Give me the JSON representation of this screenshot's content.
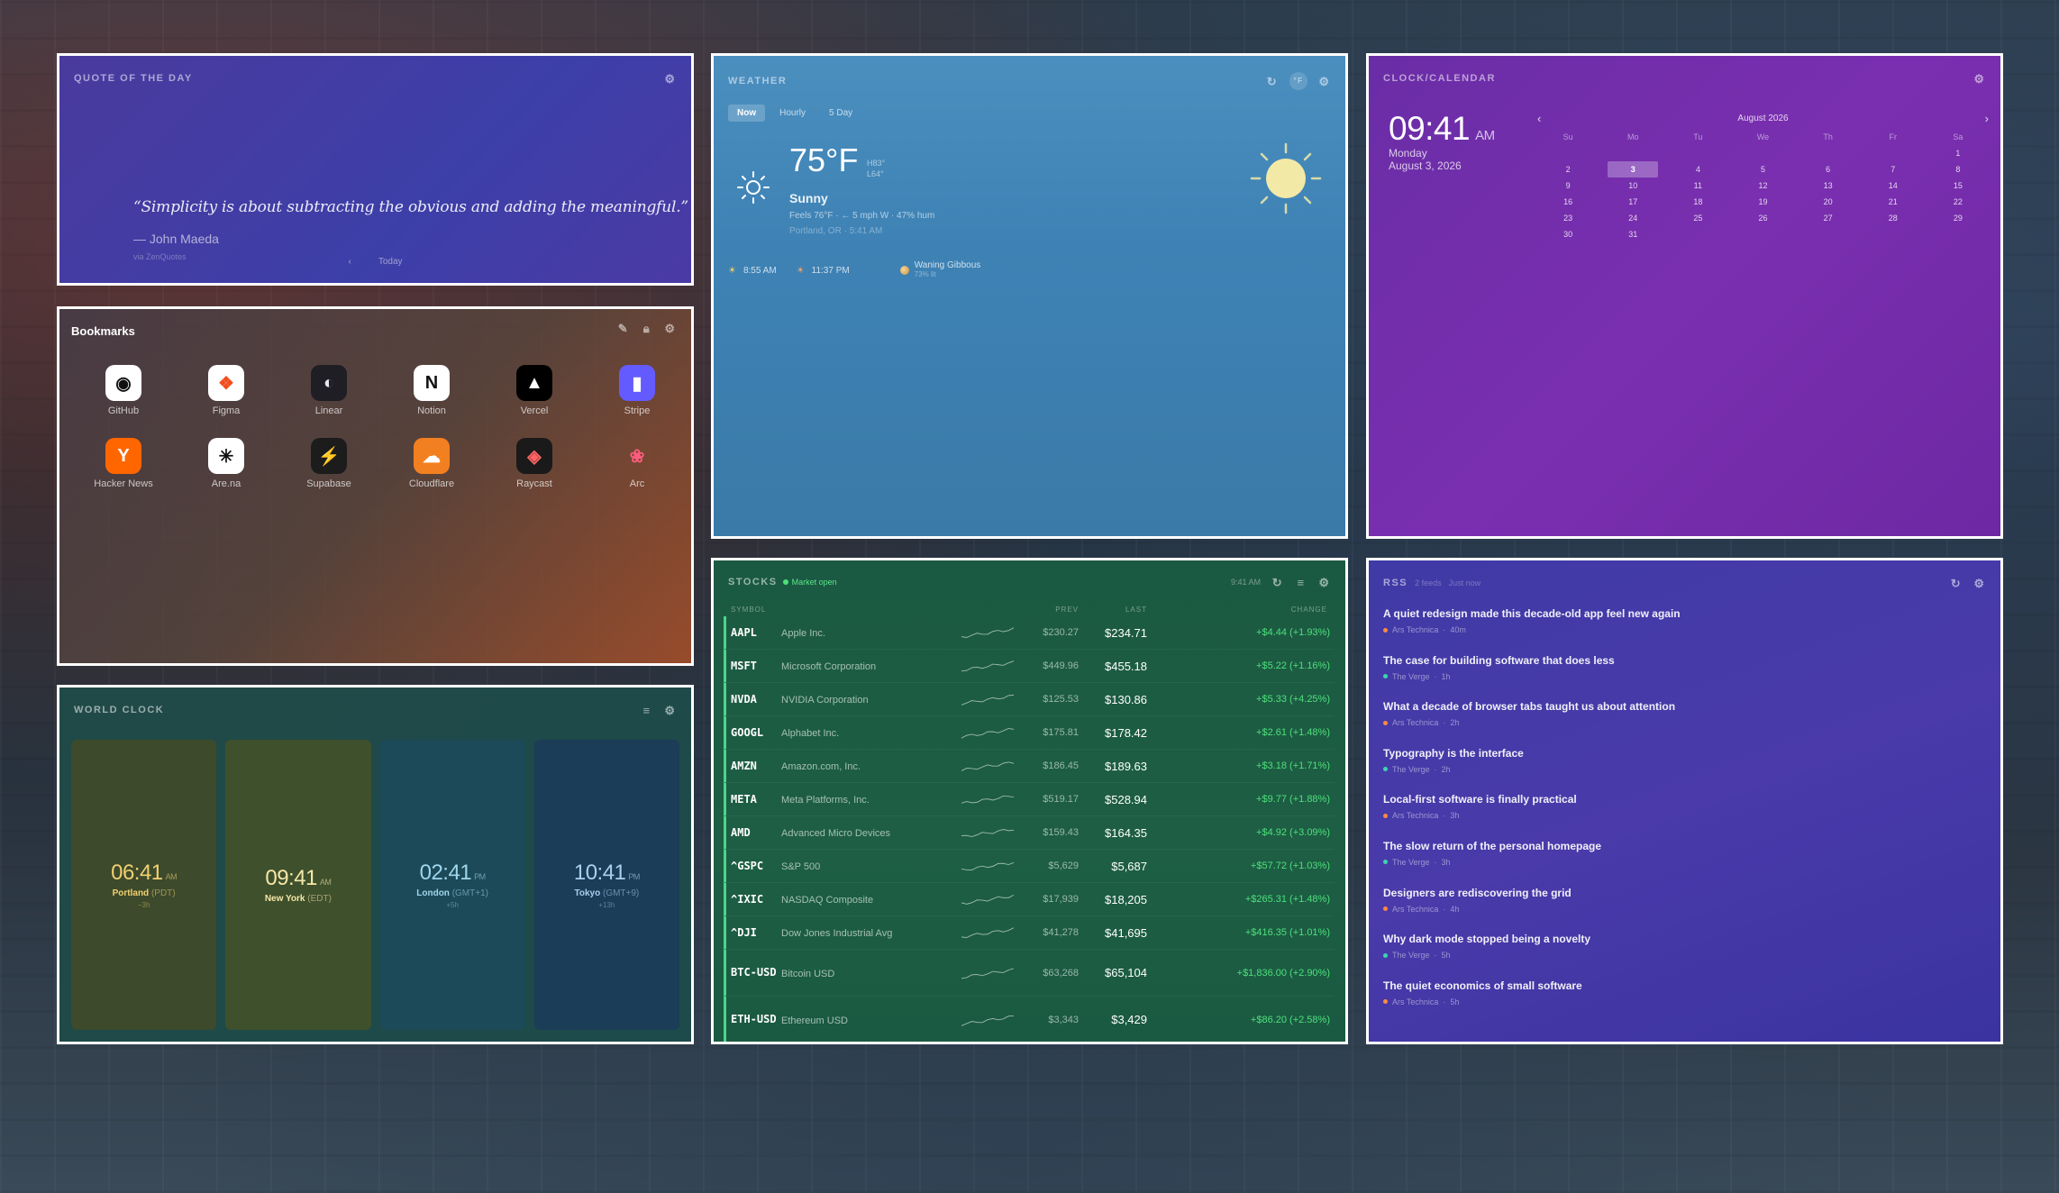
{
  "quote": {
    "title": "QUOTE OF THE DAY",
    "text": "“Simplicity is about subtracting the obvious and adding the meaningful.”",
    "author": "— John Maeda",
    "source": "via ZenQuotes",
    "nav_prev": "‹",
    "nav_label": "Today"
  },
  "bookmarks": {
    "title": "Bookmarks",
    "items": [
      {
        "label": "GitHub",
        "glyph": "◉",
        "bg": "#ffffff",
        "fg": "#111111",
        "icon": "github-icon"
      },
      {
        "label": "Figma",
        "glyph": "❖",
        "bg": "#ffffff",
        "fg": "#f24e1e",
        "icon": "figma-icon"
      },
      {
        "label": "Linear",
        "glyph": "◐",
        "bg": "#1e1e24",
        "fg": "#e6e6ef",
        "icon": "linear-icon"
      },
      {
        "label": "Notion",
        "glyph": "N",
        "bg": "#ffffff",
        "fg": "#111111",
        "icon": "notion-icon"
      },
      {
        "label": "Vercel",
        "glyph": "▲",
        "bg": "#000000",
        "fg": "#ffffff",
        "icon": "vercel-icon"
      },
      {
        "label": "Stripe",
        "glyph": "▮",
        "bg": "#635bff",
        "fg": "#ffffff",
        "icon": "stripe-icon"
      },
      {
        "label": "Hacker News",
        "glyph": "Y",
        "bg": "#ff6600",
        "fg": "#ffffff",
        "icon": "hacker-news-icon"
      },
      {
        "label": "Are.na",
        "glyph": "✳",
        "bg": "#ffffff",
        "fg": "#111111",
        "icon": "arena-icon"
      },
      {
        "label": "Supabase",
        "glyph": "⚡",
        "bg": "#1c1c1c",
        "fg": "#3ecf8e",
        "icon": "supabase-icon"
      },
      {
        "label": "Cloudflare",
        "glyph": "☁",
        "bg": "#f38020",
        "fg": "#ffffff",
        "icon": "cloudflare-icon"
      },
      {
        "label": "Raycast",
        "glyph": "◈",
        "bg": "#1a1a1a",
        "fg": "#ff6363",
        "icon": "raycast-icon"
      },
      {
        "label": "Arc",
        "glyph": "❀",
        "bg": "transparent",
        "fg": "#fc5c7d",
        "icon": "arc-icon"
      }
    ]
  },
  "worldclock": {
    "title": "WORLD CLOCK",
    "clocks": [
      {
        "time": "06:41",
        "ampm": "AM",
        "city": "Portland",
        "tz": "(PDT)",
        "offset": "−3h",
        "bg": "#3d4a2c",
        "fg": "#f0d170"
      },
      {
        "time": "09:41",
        "ampm": "AM",
        "city": "New York",
        "tz": "(EDT)",
        "offset": "",
        "bg": "#3f502c",
        "fg": "#f5e7a8"
      },
      {
        "time": "02:41",
        "ampm": "PM",
        "city": "London",
        "tz": "(GMT+1)",
        "offset": "+5h",
        "bg": "#1c4a58",
        "fg": "#9fd6ec"
      },
      {
        "time": "10:41",
        "ampm": "PM",
        "city": "Tokyo",
        "tz": "(GMT+9)",
        "offset": "+13h",
        "bg": "#1b3d58",
        "fg": "#a9cff0"
      }
    ]
  },
  "weather": {
    "title": "WEATHER",
    "unit_toggle": "°F",
    "tabs": [
      "Now",
      "Hourly",
      "5 Day"
    ],
    "temp": "75°F",
    "high": "H83°",
    "low": "L64°",
    "condition": "Sunny",
    "feels": "Feels 76°F  ·  ← 5 mph W  ·  47% hum",
    "location": "Portland, OR · 5:41 AM",
    "sunrise": "8:55 AM",
    "sunset": "11:37 PM",
    "moon_phase": "Waning Gibbous",
    "moon_illum": "73% lit"
  },
  "clock": {
    "title": "CLOCK/CALENDAR",
    "time": "09:41",
    "ampm": "AM",
    "weekday": "Monday",
    "date": "August 3, 2026",
    "month_label": "August 2026",
    "prev": "‹",
    "next": "›",
    "dow": [
      "Su",
      "Mo",
      "Tu",
      "We",
      "Th",
      "Fr",
      "Sa"
    ],
    "today": "3",
    "weeks": [
      [
        "",
        "",
        "",
        "",
        "",
        "",
        "1"
      ],
      [
        "2",
        "3",
        "4",
        "5",
        "6",
        "7",
        "8"
      ],
      [
        "9",
        "10",
        "11",
        "12",
        "13",
        "14",
        "15"
      ],
      [
        "16",
        "17",
        "18",
        "19",
        "20",
        "21",
        "22"
      ],
      [
        "23",
        "24",
        "25",
        "26",
        "27",
        "28",
        "29"
      ],
      [
        "30",
        "31",
        "",
        "",
        "",
        "",
        ""
      ]
    ]
  },
  "stocks": {
    "title": "STOCKS",
    "status": "Market open",
    "time": "9:41 AM",
    "columns": {
      "symbol": "SYMBOL",
      "prev": "PREV",
      "last": "LAST",
      "change": "CHANGE"
    },
    "rows": [
      {
        "sym": "AAPL",
        "name": "Apple Inc.",
        "prev": "$230.27",
        "last": "$234.71",
        "chg": "+$4.44 (+1.93%)",
        "tall": false
      },
      {
        "sym": "MSFT",
        "name": "Microsoft Corporation",
        "prev": "$449.96",
        "last": "$455.18",
        "chg": "+$5.22 (+1.16%)",
        "tall": false
      },
      {
        "sym": "NVDA",
        "name": "NVIDIA Corporation",
        "prev": "$125.53",
        "last": "$130.86",
        "chg": "+$5.33 (+4.25%)",
        "tall": false
      },
      {
        "sym": "GOOGL",
        "name": "Alphabet Inc.",
        "prev": "$175.81",
        "last": "$178.42",
        "chg": "+$2.61 (+1.48%)",
        "tall": false
      },
      {
        "sym": "AMZN",
        "name": "Amazon.com, Inc.",
        "prev": "$186.45",
        "last": "$189.63",
        "chg": "+$3.18 (+1.71%)",
        "tall": false
      },
      {
        "sym": "META",
        "name": "Meta Platforms, Inc.",
        "prev": "$519.17",
        "last": "$528.94",
        "chg": "+$9.77 (+1.88%)",
        "tall": false
      },
      {
        "sym": "AMD",
        "name": "Advanced Micro Devices",
        "prev": "$159.43",
        "last": "$164.35",
        "chg": "+$4.92 (+3.09%)",
        "tall": false
      },
      {
        "sym": "^GSPC",
        "name": "S&P 500",
        "prev": "$5,629",
        "last": "$5,687",
        "chg": "+$57.72 (+1.03%)",
        "tall": false
      },
      {
        "sym": "^IXIC",
        "name": "NASDAQ Composite",
        "prev": "$17,939",
        "last": "$18,205",
        "chg": "+$265.31 (+1.48%)",
        "tall": false
      },
      {
        "sym": "^DJI",
        "name": "Dow Jones Industrial Avg",
        "prev": "$41,278",
        "last": "$41,695",
        "chg": "+$416.35 (+1.01%)",
        "tall": false
      },
      {
        "sym": "BTC-USD",
        "name": "Bitcoin USD",
        "prev": "$63,268",
        "last": "$65,104",
        "chg": "+$1,836.00 (+2.90%)",
        "tall": true
      },
      {
        "sym": "ETH-USD",
        "name": "Ethereum USD",
        "prev": "$3,343",
        "last": "$3,429",
        "chg": "+$86.20 (+2.58%)",
        "tall": true
      }
    ]
  },
  "rss": {
    "title": "RSS",
    "feeds": "2 feeds",
    "updated": "Just now",
    "items": [
      {
        "title": "A quiet redesign made this decade-old app feel new again",
        "source": "Ars Technica",
        "age": "40m",
        "dot": "#ff8a3d"
      },
      {
        "title": "The case for building software that does less",
        "source": "The Verge",
        "age": "1h",
        "dot": "#3ad6b0"
      },
      {
        "title": "What a decade of browser tabs taught us about attention",
        "source": "Ars Technica",
        "age": "2h",
        "dot": "#ff8a3d"
      },
      {
        "title": "Typography is the interface",
        "source": "The Verge",
        "age": "2h",
        "dot": "#3ad6b0"
      },
      {
        "title": "Local-first software is finally practical",
        "source": "Ars Technica",
        "age": "3h",
        "dot": "#ff8a3d"
      },
      {
        "title": "The slow return of the personal homepage",
        "source": "The Verge",
        "age": "3h",
        "dot": "#3ad6b0"
      },
      {
        "title": "Designers are rediscovering the grid",
        "source": "Ars Technica",
        "age": "4h",
        "dot": "#ff8a3d"
      },
      {
        "title": "Why dark mode stopped being a novelty",
        "source": "The Verge",
        "age": "5h",
        "dot": "#3ad6b0"
      },
      {
        "title": "The quiet economics of small software",
        "source": "Ars Technica",
        "age": "5h",
        "dot": "#ff8a3d"
      }
    ]
  }
}
